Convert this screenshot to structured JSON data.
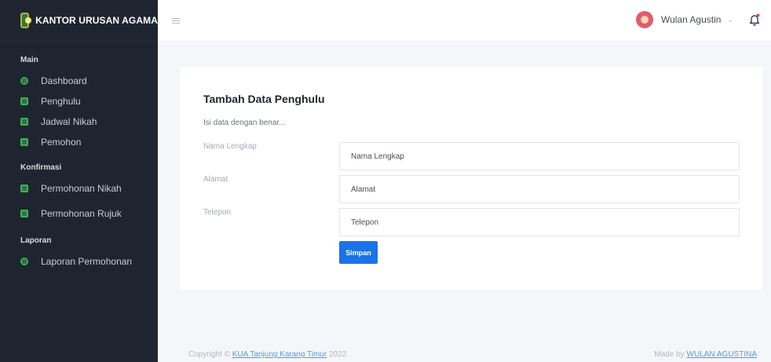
{
  "brand": {
    "title": "KANTOR URUSAN AGAMA"
  },
  "sidebar": {
    "sections": [
      {
        "heading": "Main",
        "items": [
          {
            "label": "Dashboard",
            "icon": "dashboard-icon"
          },
          {
            "label": "Penghulu",
            "icon": "id-card-icon"
          },
          {
            "label": "Jadwal Nikah",
            "icon": "calendar-icon"
          },
          {
            "label": "Pemohon",
            "icon": "user-card-icon"
          }
        ]
      },
      {
        "heading": "Konfirmasi",
        "items": [
          {
            "label": "Permohonan Nikah",
            "icon": "grid-icon"
          },
          {
            "label": "Permohonan Rujuk",
            "icon": "flow-icon"
          }
        ]
      },
      {
        "heading": "Laporan",
        "items": [
          {
            "label": "Laporan Permohonan",
            "icon": "printer-icon"
          }
        ]
      }
    ]
  },
  "topbar": {
    "user_name": "Wulan Agustin",
    "caret": "⌄"
  },
  "form": {
    "title": "Tambah Data Penghulu",
    "subtitle": "Isi data dengan benar...",
    "fields": [
      {
        "label": "Nama Lengkap",
        "placeholder": "Nama Lengkap",
        "value": ""
      },
      {
        "label": "Alamat",
        "placeholder": "Alamat",
        "value": ""
      },
      {
        "label": "Telepon",
        "placeholder": "Telepon",
        "value": ""
      }
    ],
    "submit_label": "Simpan"
  },
  "footer": {
    "copyright_prefix": "Copyright © ",
    "copyright_link": "KUA Tanjung Karang Timur",
    "copyright_suffix": " 2022",
    "made_by_prefix": "Made by ",
    "made_by_link": "WULAN AGUSTINA"
  },
  "colors": {
    "sidebar_bg": "#1f2530",
    "accent_green": "#3cb357",
    "primary_button": "#1a73e8",
    "page_bg": "#f4f6f9"
  }
}
